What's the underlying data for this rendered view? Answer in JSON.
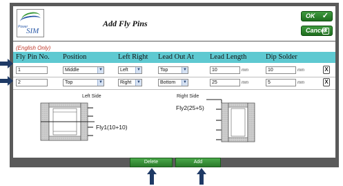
{
  "header": {
    "logo_text_small": "Power",
    "logo_text_big": "SIM",
    "title": "Add Fly Pins",
    "ok_label": "OK",
    "cancel_label": "Cancel"
  },
  "note": "(English Only)",
  "columns": [
    "Fly Pin No.",
    "Position",
    "Left Right",
    "Lead Out At",
    "Lead Length",
    "Dip Solder"
  ],
  "rows": [
    {
      "pin_no": "1",
      "position": "Middle",
      "left_right": "Left",
      "lead_out_at": "Top",
      "lead_length": "10",
      "dip_solder": "10",
      "unit": "mm",
      "delete": "X"
    },
    {
      "pin_no": "2",
      "position": "Top",
      "left_right": "Right",
      "lead_out_at": "Bottom",
      "lead_length": "25",
      "dip_solder": "5",
      "unit": "mm",
      "delete": "X"
    }
  ],
  "diagram": {
    "left_title": "Left Side",
    "right_title": "Right Side",
    "left_pin_label": "Fly1(10+10)",
    "right_pin_label": "Fly2(25+5)"
  },
  "footer": {
    "delete_label": "Delete",
    "add_label": "Add"
  },
  "colors": {
    "table_header": "#5ec9d1",
    "button_green": "#2a7a2a",
    "frame": "#5a5a5a",
    "note_red": "#c0392b",
    "arrow": "#1f3a66"
  }
}
